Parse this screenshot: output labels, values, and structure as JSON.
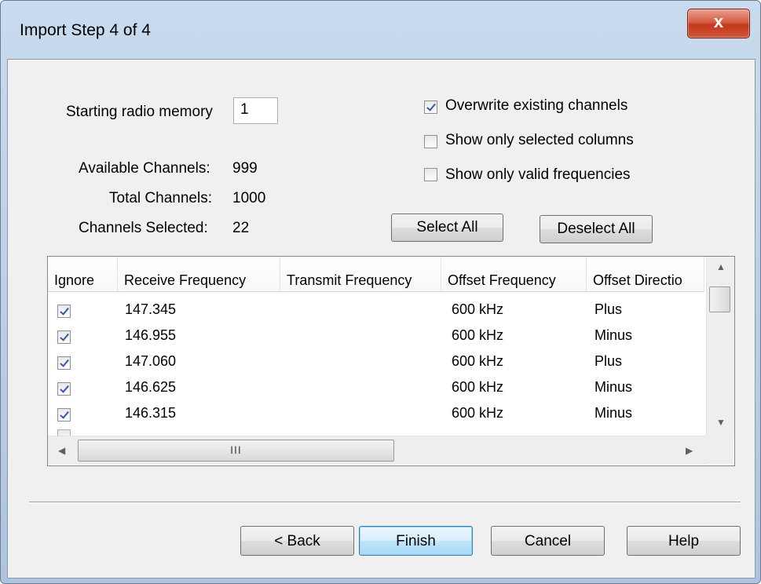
{
  "window": {
    "title": "Import Step 4 of 4",
    "close_label": "x"
  },
  "form": {
    "starting_memory_label": "Starting radio memory",
    "starting_memory_value": "1",
    "available_label": "Available Channels:",
    "available_value": "999",
    "total_label": "Total Channels:",
    "total_value": "1000",
    "selected_label": "Channels Selected:",
    "selected_value": "22"
  },
  "options": [
    {
      "label": "Overwrite existing channels",
      "checked": true
    },
    {
      "label": "Show only selected columns",
      "checked": false
    },
    {
      "label": "Show only valid frequencies",
      "checked": false
    }
  ],
  "buttons": {
    "select_all": "Select All",
    "deselect_all": "Deselect All",
    "back": "< Back",
    "finish": "Finish",
    "cancel": "Cancel",
    "help": "Help"
  },
  "grid": {
    "columns": [
      "Ignore",
      "Receive Frequency",
      "Transmit Frequency",
      "Offset Frequency",
      "Offset Directio"
    ],
    "rows": [
      {
        "ignore": true,
        "rx": "147.345",
        "tx": "",
        "offset": "600 kHz",
        "dir": "Plus"
      },
      {
        "ignore": true,
        "rx": "146.955",
        "tx": "",
        "offset": "600 kHz",
        "dir": "Minus"
      },
      {
        "ignore": true,
        "rx": "147.060",
        "tx": "",
        "offset": "600 kHz",
        "dir": "Plus"
      },
      {
        "ignore": true,
        "rx": "146.625",
        "tx": "",
        "offset": "600 kHz",
        "dir": "Minus"
      },
      {
        "ignore": true,
        "rx": "146.315",
        "tx": "",
        "offset": "600 kHz",
        "dir": "Minus"
      }
    ],
    "hscroll_grip": "III"
  },
  "icons": {
    "check": "checkmark-icon",
    "close": "close-icon",
    "scroll_up": "arrow-up-icon",
    "scroll_down": "arrow-down-icon",
    "scroll_left": "arrow-left-icon",
    "scroll_right": "arrow-right-icon"
  },
  "colors": {
    "titlebar": "#b9cfe6",
    "close": "#c2381c",
    "default_button": "#bee6fd",
    "client": "#f0f0f0"
  }
}
